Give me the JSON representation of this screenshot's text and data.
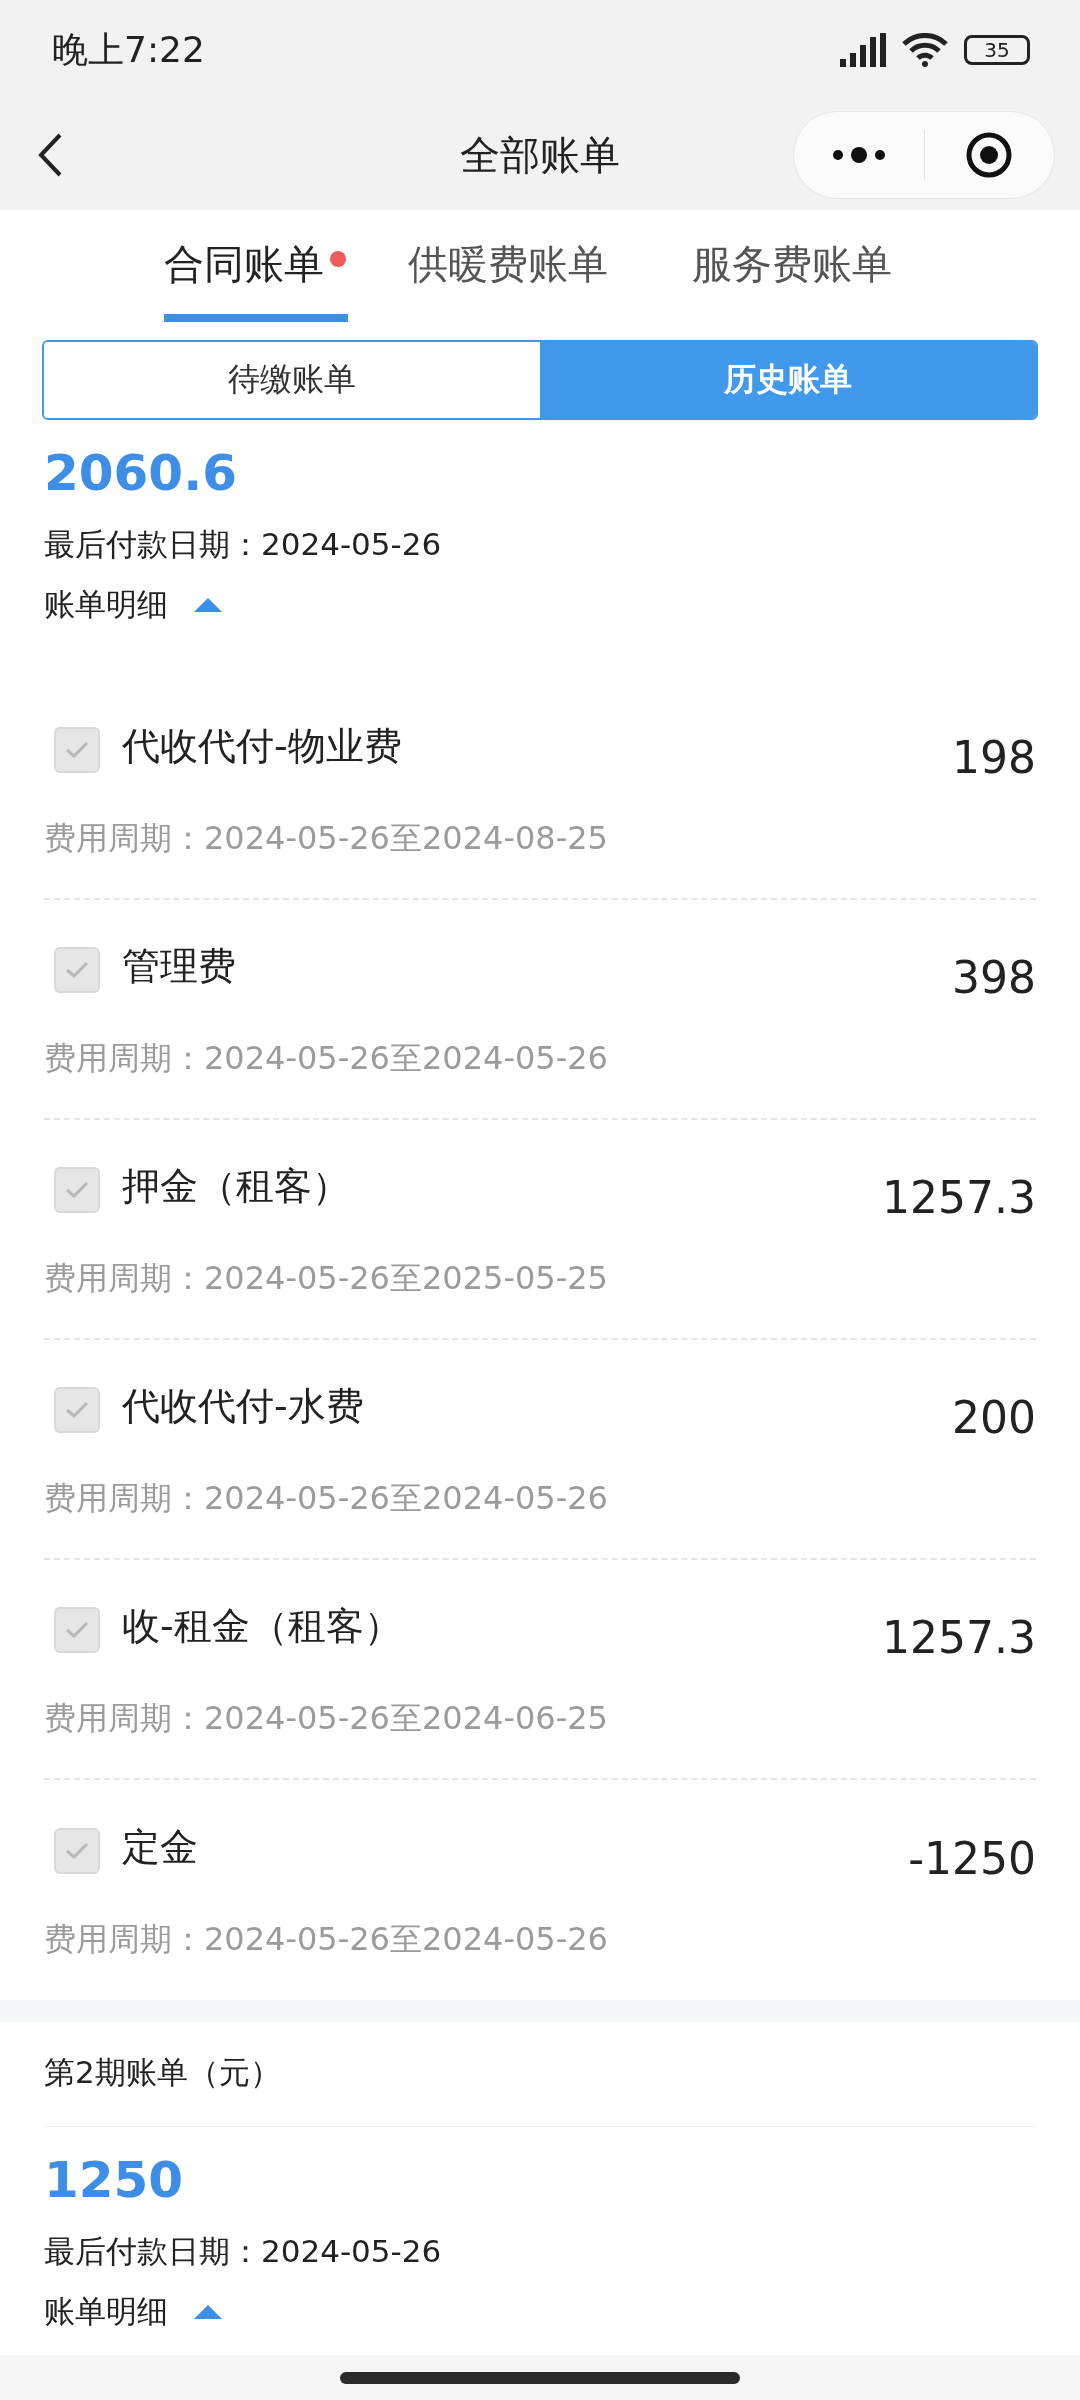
{
  "status_bar": {
    "time": "晚上7:22",
    "battery": "35"
  },
  "nav": {
    "title": "全部账单"
  },
  "tabs": [
    {
      "label": "合同账单",
      "selected": true,
      "dot": true
    },
    {
      "label": "供暖费账单",
      "selected": false,
      "dot": false
    },
    {
      "label": "服务费账单",
      "selected": false,
      "dot": false
    }
  ],
  "segments": [
    {
      "label": "待缴账单",
      "selected": false
    },
    {
      "label": "历史账单",
      "selected": true
    }
  ],
  "bills": [
    {
      "total": "2060.6",
      "due": "最后付款日期：2024-05-26",
      "detail_label": "账单明细",
      "expanded": true,
      "items": [
        {
          "name": "代收代付-物业费",
          "amount": "198",
          "period": "费用周期：2024-05-26至2024-08-25",
          "checked": true,
          "disabled": true
        },
        {
          "name": "管理费",
          "amount": "398",
          "period": "费用周期：2024-05-26至2024-05-26",
          "checked": true,
          "disabled": true
        },
        {
          "name": "押金（租客）",
          "amount": "1257.3",
          "period": "费用周期：2024-05-26至2025-05-25",
          "checked": true,
          "disabled": true
        },
        {
          "name": "代收代付-水费",
          "amount": "200",
          "period": "费用周期：2024-05-26至2024-05-26",
          "checked": true,
          "disabled": true
        },
        {
          "name": "收-租金（租客）",
          "amount": "1257.3",
          "period": "费用周期：2024-05-26至2024-06-25",
          "checked": true,
          "disabled": true
        },
        {
          "name": "定金",
          "amount": "-1250",
          "period": "费用周期：2024-05-26至2024-05-26",
          "checked": true,
          "disabled": true
        }
      ]
    },
    {
      "title": "第2期账单（元）",
      "total": "1250",
      "due": "最后付款日期：2024-05-26",
      "detail_label": "账单明细",
      "expanded": true
    }
  ]
}
